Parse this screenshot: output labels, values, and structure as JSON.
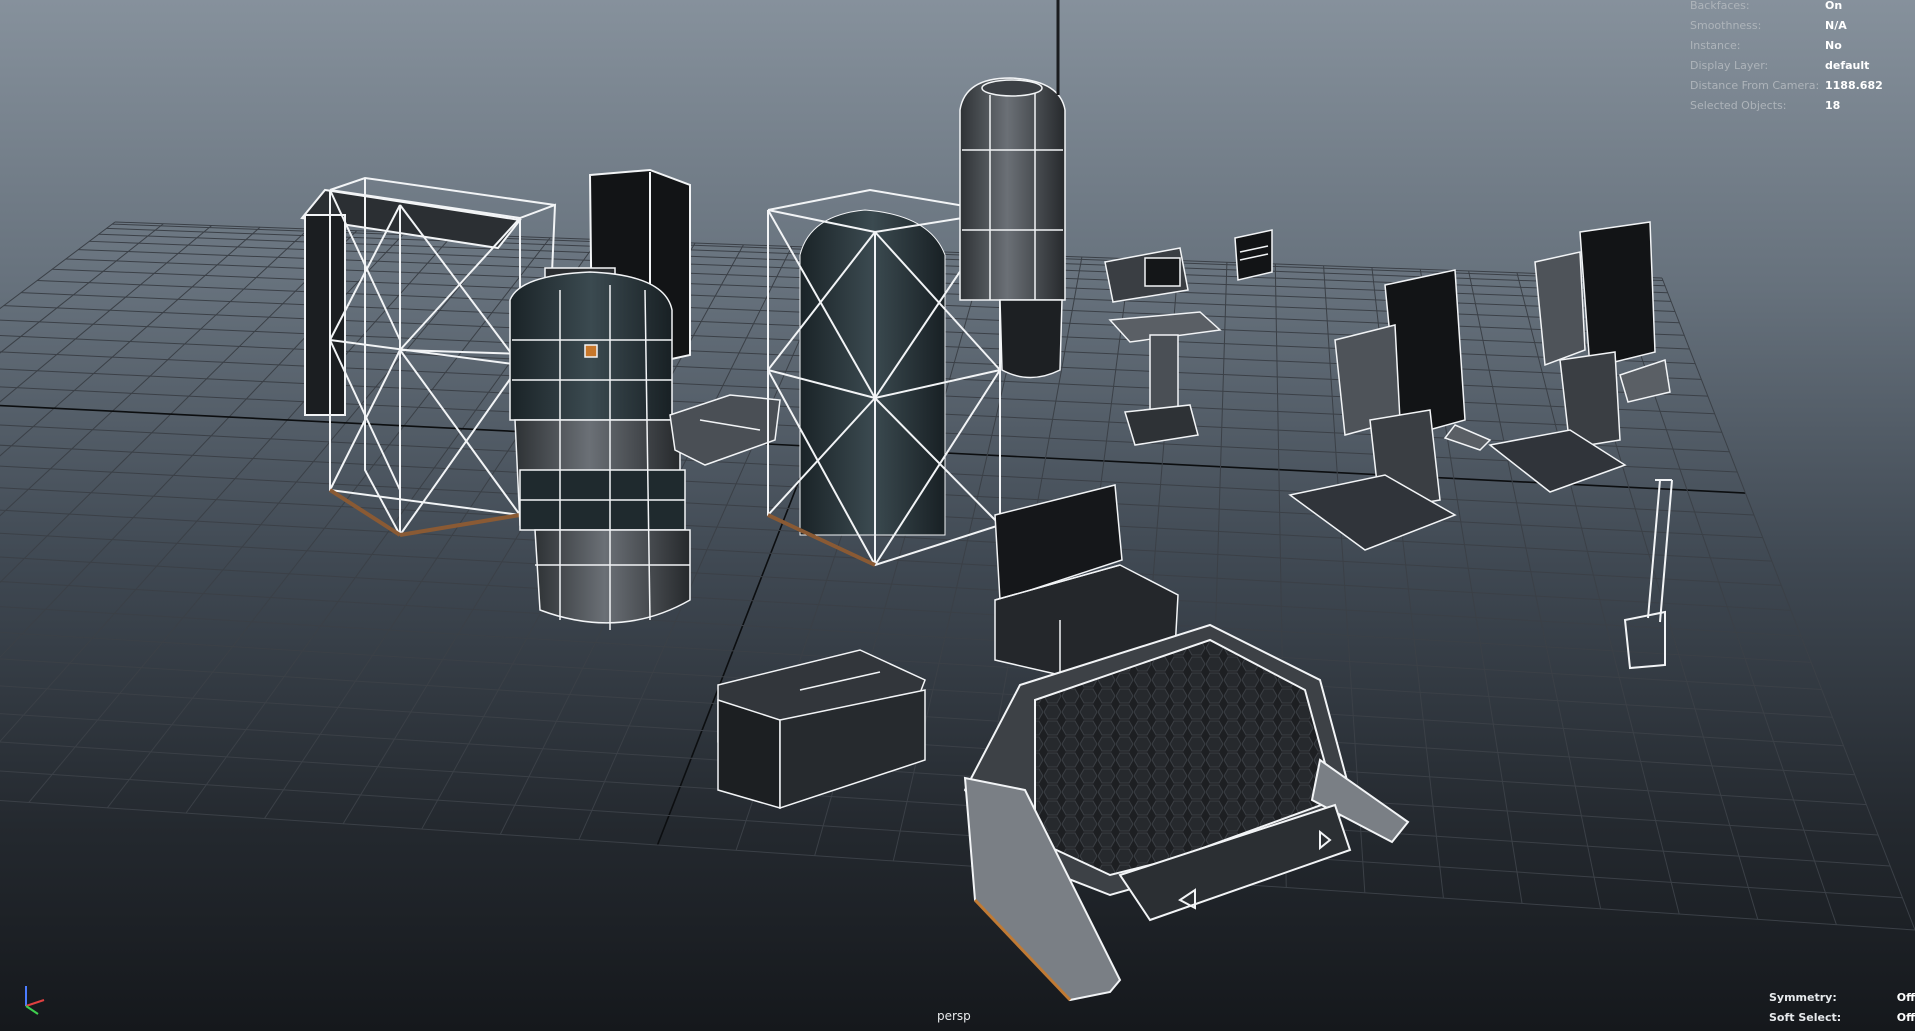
{
  "viewport": {
    "camera": "persp",
    "heads_up_top": [
      {
        "label": "Backfaces:",
        "value": "On"
      },
      {
        "label": "Smoothness:",
        "value": "N/A"
      },
      {
        "label": "Instance:",
        "value": "No"
      },
      {
        "label": "Display Layer:",
        "value": "default"
      },
      {
        "label": "Distance From Camera:",
        "value": "1188.682"
      },
      {
        "label": "Selected Objects:",
        "value": "18"
      }
    ],
    "heads_up_bottom": [
      {
        "label": "Symmetry:",
        "value": "Off"
      },
      {
        "label": "Soft Select:",
        "value": "Off"
      }
    ]
  },
  "scene_objects": [
    "cargo-frame-left",
    "tall-black-panel",
    "fuel-canister-left",
    "floor-connector-plate",
    "cargo-frame-center",
    "fuel-tank-tall",
    "antenna-mast",
    "small-display-terminal",
    "small-screen-panel",
    "control-console-left",
    "control-console-right",
    "signal-post",
    "supply-crate-open",
    "supply-crate-closed",
    "hex-landing-pad"
  ],
  "colors": {
    "background_top": "#86919c",
    "background_bottom": "#15181c",
    "grid_line": "#3b4047",
    "grid_axis": "#0c0e10",
    "wire": "#f2f4f6",
    "metal": "#6b7076"
  }
}
